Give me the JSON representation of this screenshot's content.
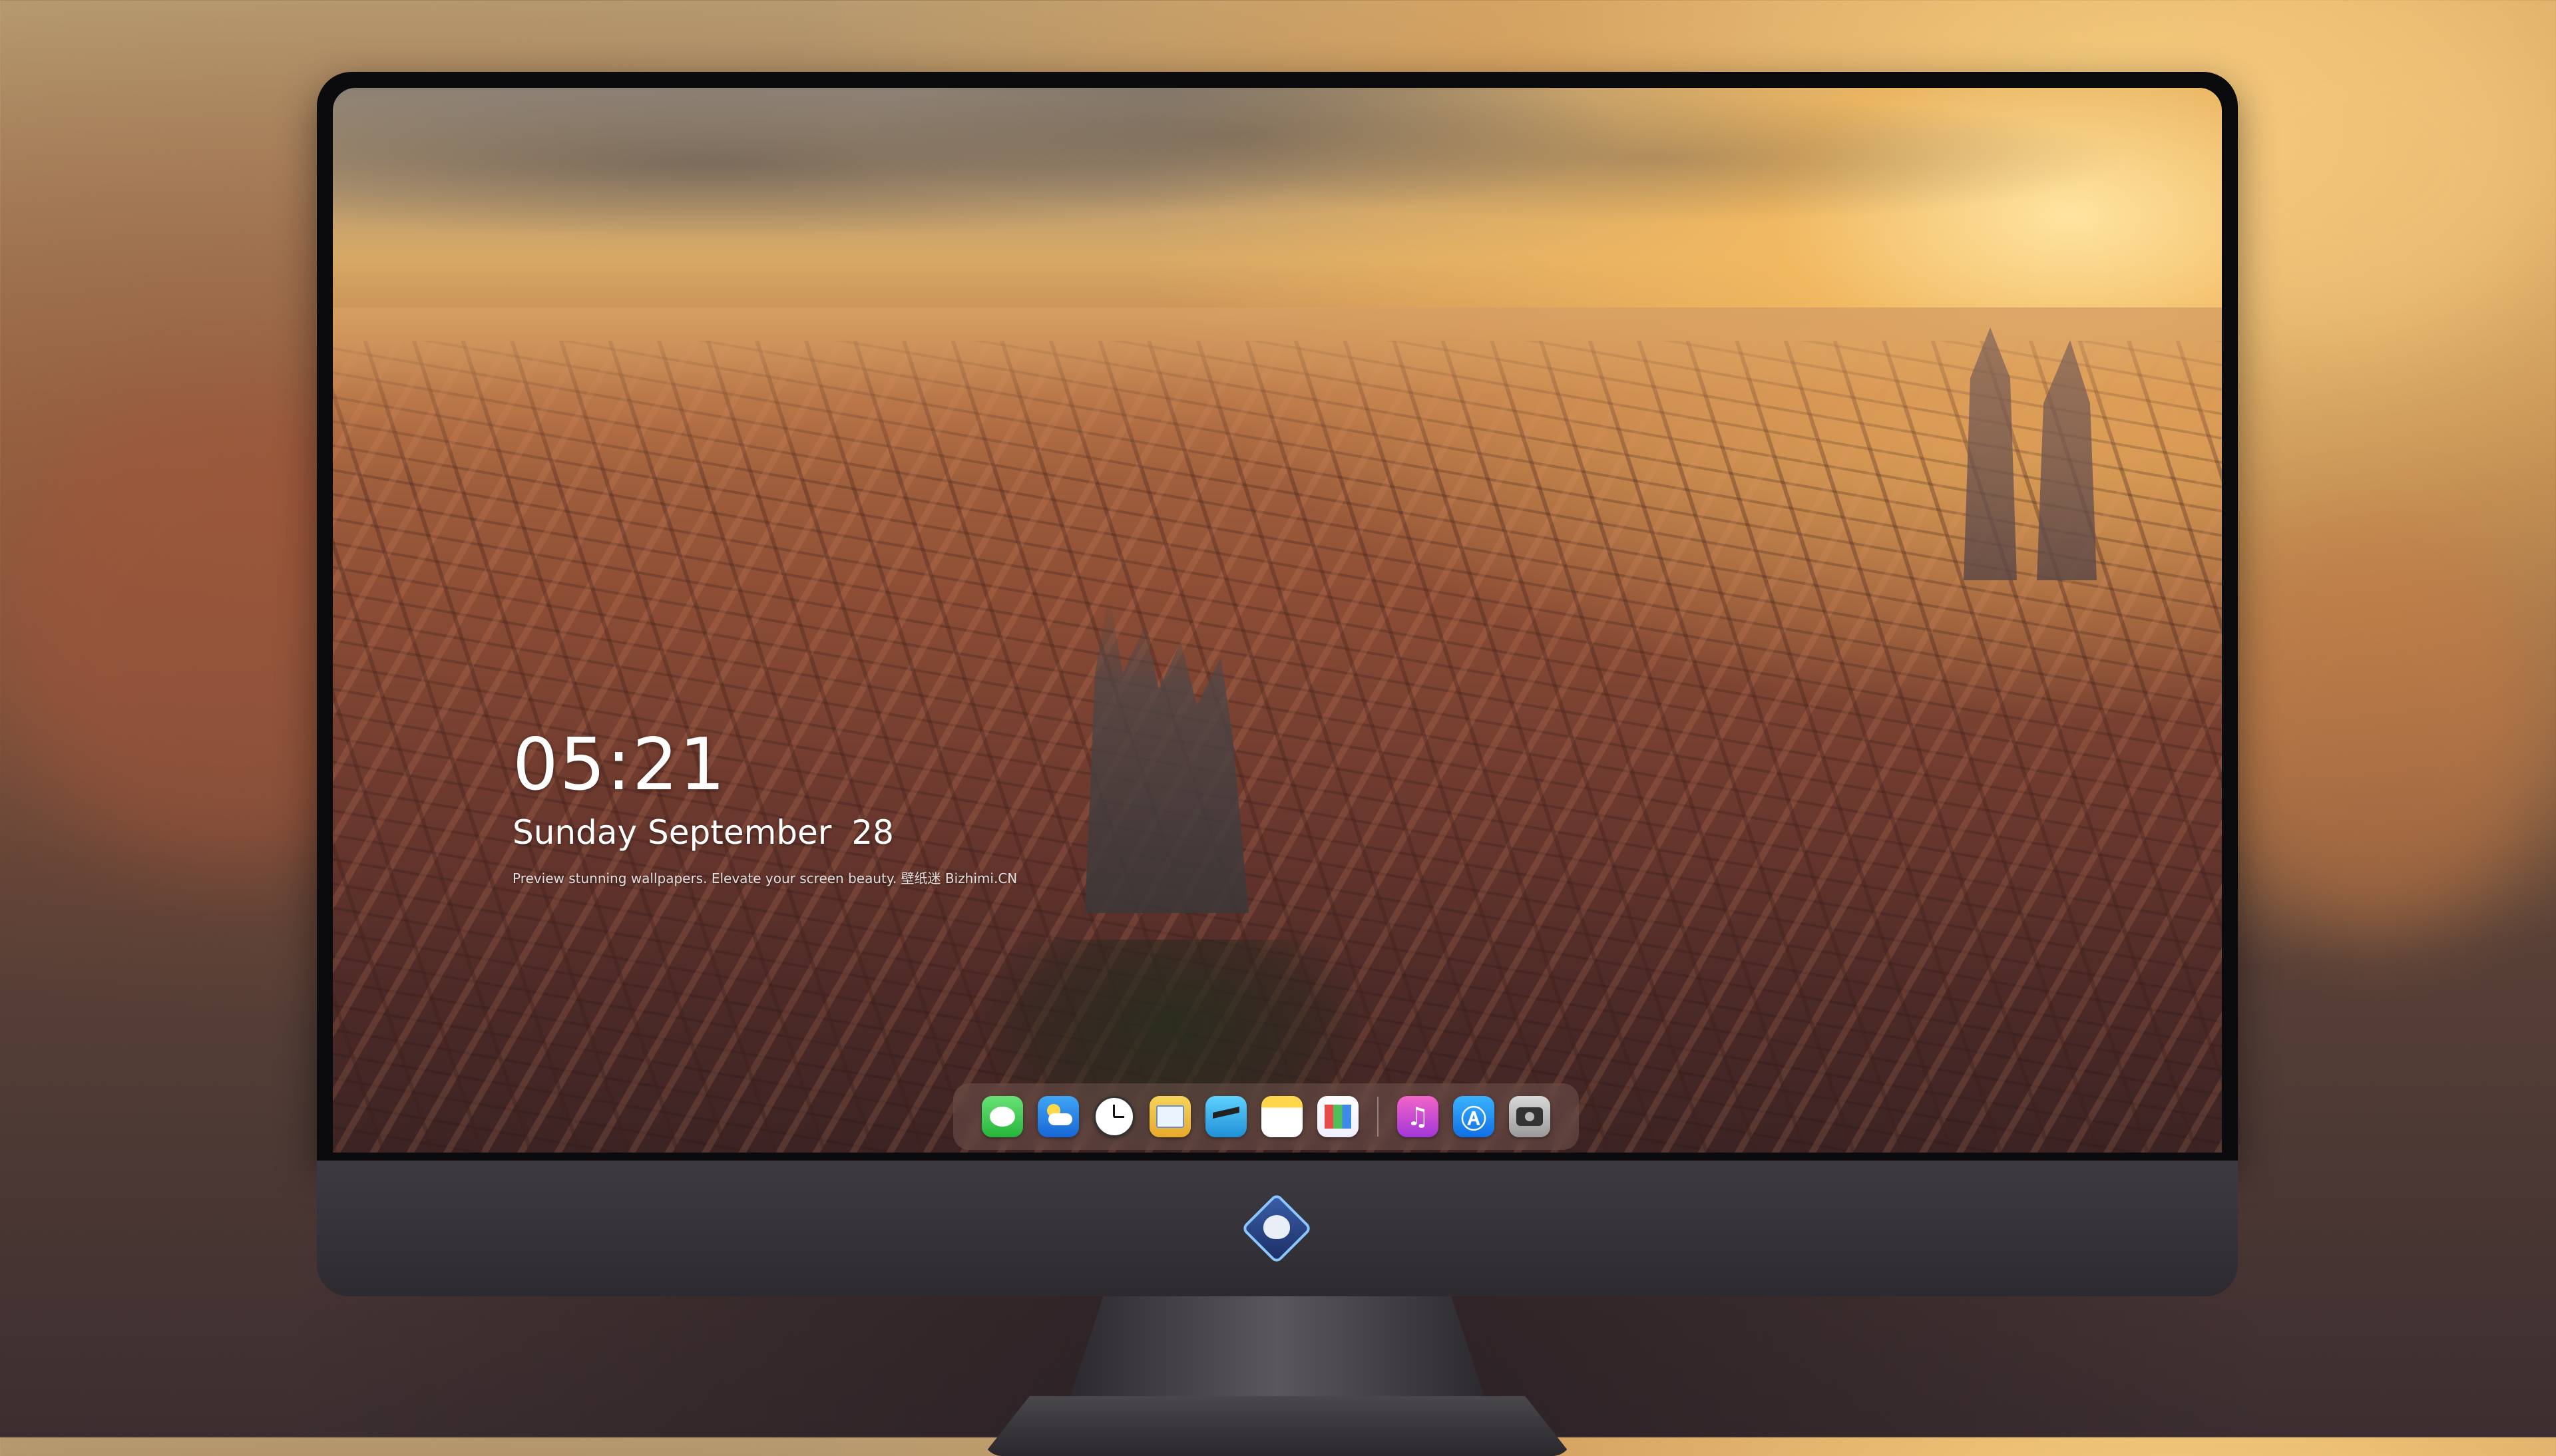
{
  "lock_screen": {
    "time": "05:21",
    "day": "Sunday",
    "month": "September",
    "date_num": "28",
    "tagline": "Preview stunning wallpapers. Elevate your screen beauty. 壁纸迷 Bizhimi.CN"
  },
  "dock": {
    "apps": [
      {
        "name": "Messages",
        "icon": "messages-icon"
      },
      {
        "name": "Weather",
        "icon": "weather-icon"
      },
      {
        "name": "Clock",
        "icon": "clock-icon"
      },
      {
        "name": "Preview",
        "icon": "preview-icon"
      },
      {
        "name": "Clips",
        "icon": "clips-icon"
      },
      {
        "name": "Notes",
        "icon": "notes-icon"
      },
      {
        "name": "Photos",
        "icon": "photos-icon"
      },
      {
        "name": "Music",
        "icon": "music-icon",
        "glyph": "♫"
      },
      {
        "name": "App Store",
        "icon": "app-store-icon",
        "glyph": "Ⓐ"
      },
      {
        "name": "Camera",
        "icon": "camera-icon"
      }
    ]
  },
  "colors": {
    "monitor_chin": "#343137",
    "bezel": "#0b0b0d",
    "sky_glow": "#ffe4a0"
  }
}
